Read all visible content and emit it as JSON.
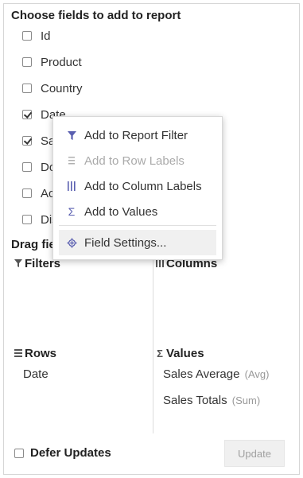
{
  "fields_title": "Choose fields to add to report",
  "fields": [
    {
      "label": "Id",
      "checked": false
    },
    {
      "label": "Product",
      "checked": false
    },
    {
      "label": "Country",
      "checked": false
    },
    {
      "label": "Date",
      "checked": true
    },
    {
      "label": "Sales",
      "checked": true
    },
    {
      "label": "Downloads",
      "checked": false
    },
    {
      "label": "Active",
      "checked": false
    },
    {
      "label": "Discount",
      "checked": false
    }
  ],
  "drag_title": "Drag fields between areas below:",
  "areas": {
    "filters": {
      "label": "Filters",
      "icon": "filter-icon"
    },
    "columns": {
      "label": "Columns",
      "icon": "columns-icon"
    },
    "rows": {
      "label": "Rows",
      "icon": "rows-icon",
      "items": [
        "Date"
      ]
    },
    "values": {
      "label": "Values",
      "icon": "sigma-icon",
      "items": [
        {
          "label": "Sales Average",
          "agg": "(Avg)"
        },
        {
          "label": "Sales Totals",
          "agg": "(Sum)"
        }
      ]
    }
  },
  "defer_updates": {
    "label": "Defer Updates",
    "checked": false
  },
  "update_button": "Update",
  "context_menu": {
    "items": [
      {
        "label": "Add to Report Filter",
        "icon": "filter-icon",
        "disabled": false
      },
      {
        "label": "Add to Row Labels",
        "icon": "rows-icon",
        "disabled": true
      },
      {
        "label": "Add to Column Labels",
        "icon": "columns-icon",
        "disabled": false
      },
      {
        "label": "Add to Values",
        "icon": "sigma-icon",
        "disabled": false
      }
    ],
    "settings": {
      "label": "Field Settings...",
      "icon": "gear-icon"
    }
  },
  "colors": {
    "accent": "#5a5fb0",
    "disabled_text": "#aaaaaa",
    "border": "#d6d6d6"
  }
}
